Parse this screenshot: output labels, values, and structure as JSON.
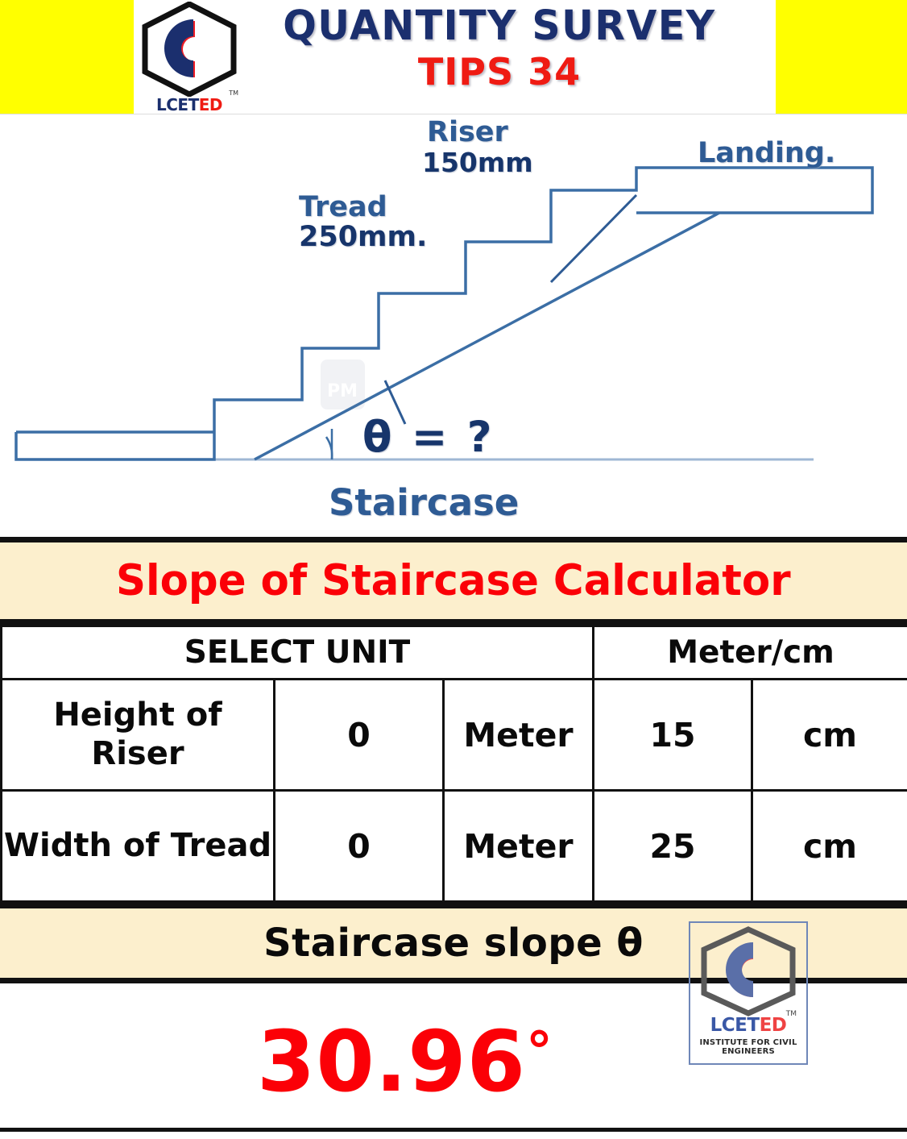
{
  "banner": {
    "title": "QUANTITY SURVEY",
    "subtitle": "TIPS 34",
    "logo_word_part1": "LCET",
    "logo_word_part2": "ED",
    "logo_tm": "TM",
    "logo_icon": "lceted-hexagon-cc-logo",
    "background_color": "#FFFF00",
    "title_color": "#1B2F6E",
    "subtitle_color": "#EF1B13"
  },
  "diagram": {
    "riser_label": "Riser",
    "riser_value": "150mm",
    "tread_label": "Tread",
    "tread_value": "250mm.",
    "landing_label": "Landing.",
    "angle_label": "θ = ?",
    "caption": "Staircase",
    "line_color": "#3B6EA5"
  },
  "calculator": {
    "title": "Slope of Staircase Calculator",
    "title_color": "#FB0007",
    "band_color": "#FCEFCD",
    "header": {
      "select_unit": "SELECT UNIT",
      "meter_cm": "Meter/cm"
    },
    "rows": [
      {
        "label": "Height of Riser",
        "meter_value": "0",
        "meter_unit": "Meter",
        "cm_value": "15",
        "cm_unit": "cm"
      },
      {
        "label": "Width of Tread",
        "meter_value": "0",
        "meter_unit": "Meter",
        "cm_value": "25",
        "cm_unit": "cm"
      }
    ],
    "result_label": "Staircase slope θ",
    "result_value": "30.96",
    "result_degree_symbol": "°",
    "result_color": "#FB0007"
  },
  "watermark": {
    "word_part1": "LCET",
    "word_part2": "ED",
    "tm": "TM",
    "tagline": "INSTITUTE FOR CIVIL ENGINEERS",
    "icon": "lceted-hexagon-cc-logo"
  }
}
